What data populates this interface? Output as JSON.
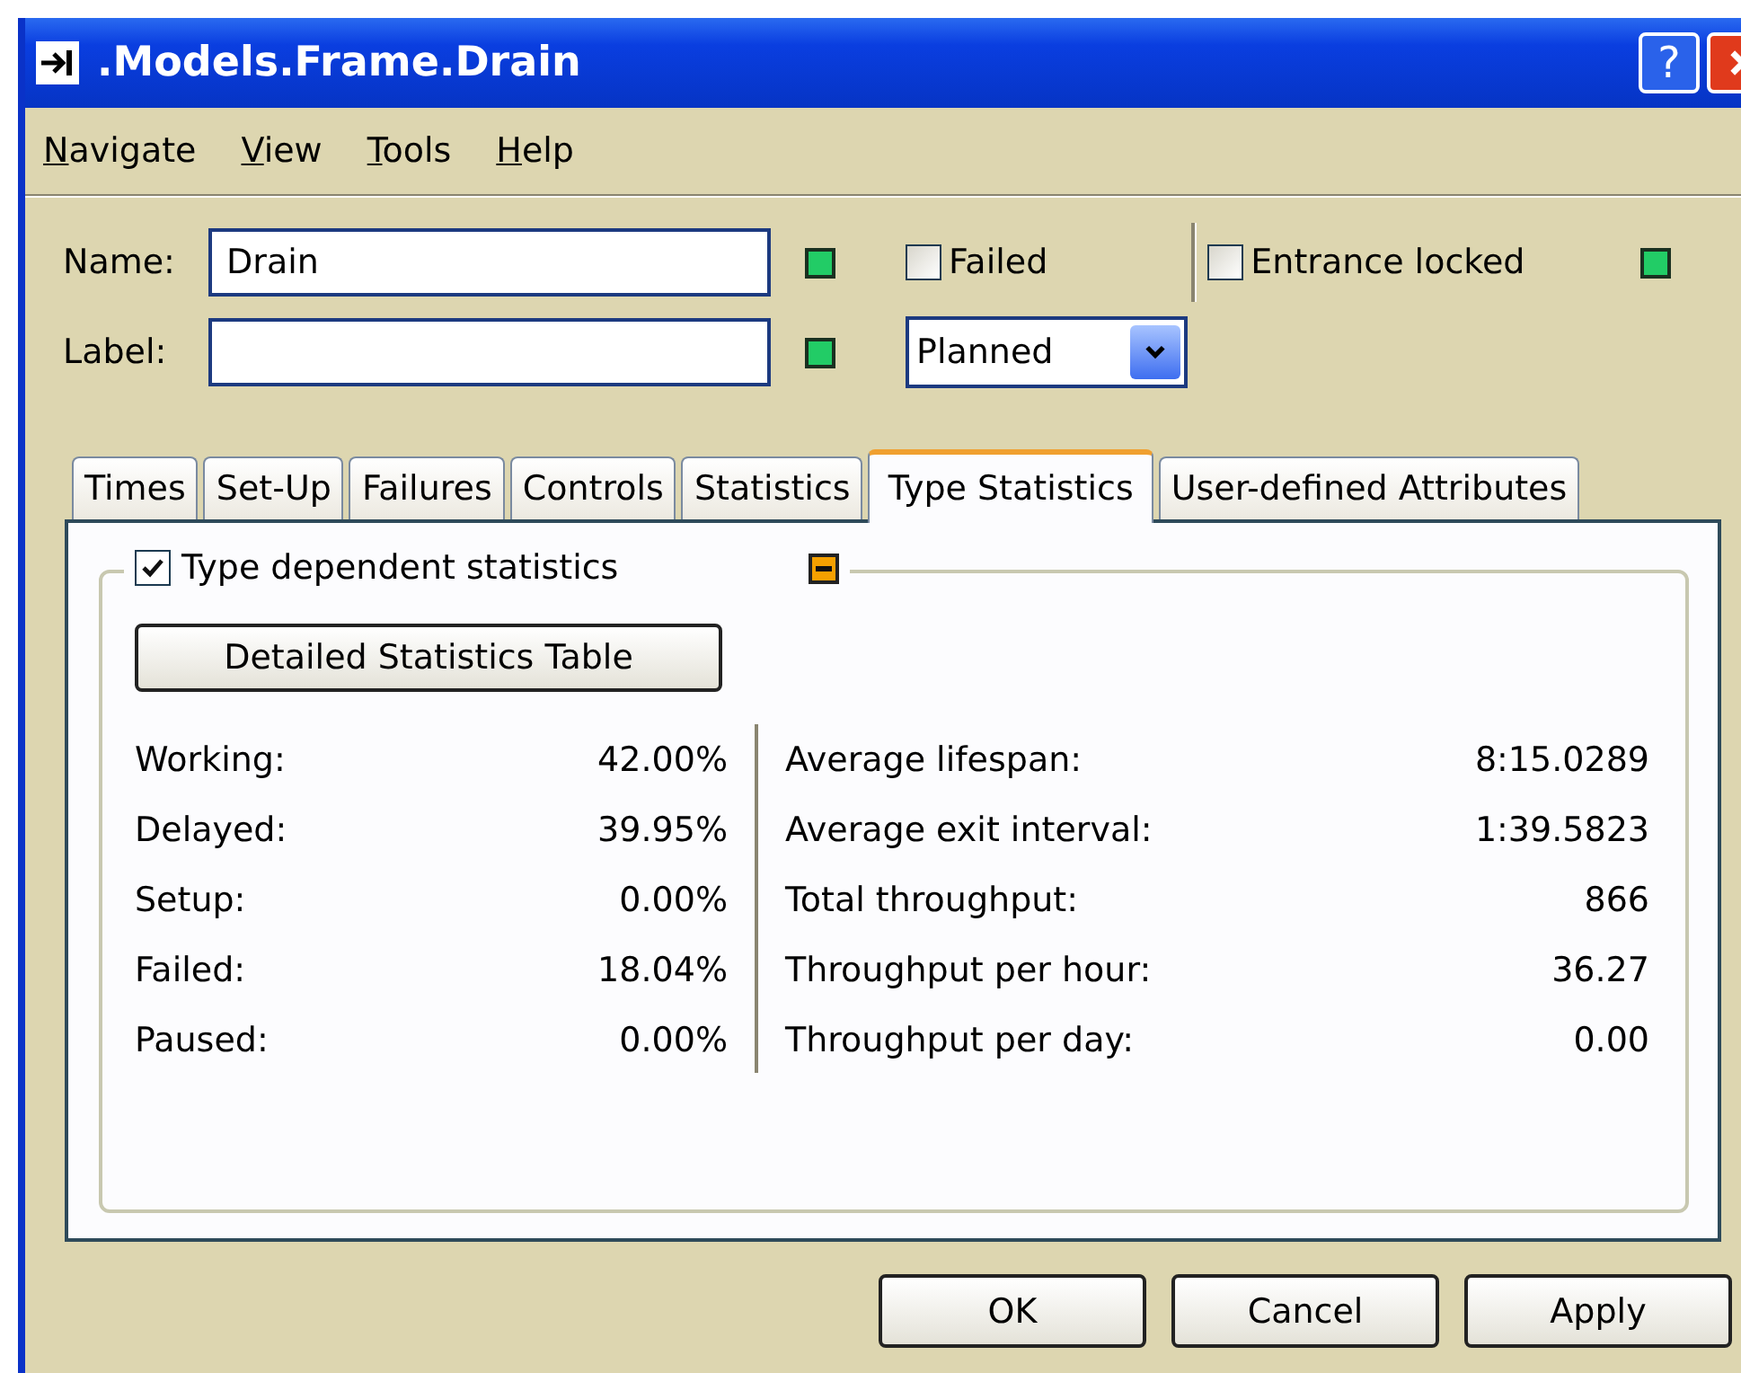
{
  "window": {
    "title": ".Models.Frame.Drain",
    "help_button": "?"
  },
  "menu": [
    "Navigate",
    "View",
    "Tools",
    "Help"
  ],
  "name_field": {
    "label": "Name:",
    "value": "Drain",
    "indicator": {
      "color": "#22cc66"
    }
  },
  "label_field": {
    "label": "Label:",
    "indicator": {
      "color": "#22cc66"
    }
  },
  "failed": {
    "label": "Failed",
    "checked": false
  },
  "entrance_locked": {
    "label": "Entrance locked",
    "checked": false,
    "indicator": {
      "color": "#22cc66"
    }
  },
  "mode_dropdown": {
    "value": "Planned"
  },
  "tabs": [
    {
      "label": "Times",
      "selected": false
    },
    {
      "label": "Set-Up",
      "selected": false
    },
    {
      "label": "Failures",
      "selected": false
    },
    {
      "label": "Controls",
      "selected": false
    },
    {
      "label": "Statistics",
      "selected": false
    },
    {
      "label": "Type Statistics",
      "selected": true
    },
    {
      "label": "User-defined Attributes",
      "selected": false
    }
  ],
  "group": {
    "label": "Type dependent statistics",
    "checked": true,
    "indicator": {
      "color": "#f5a000"
    },
    "button": "Detailed Statistics Table"
  },
  "left_stats": [
    {
      "label": "Working:",
      "value": "42.00%"
    },
    {
      "label": "Delayed:",
      "value": "39.95%"
    },
    {
      "label": "Setup:",
      "value": "0.00%"
    },
    {
      "label": "Failed:",
      "value": "18.04%"
    },
    {
      "label": "Paused:",
      "value": "0.00%"
    }
  ],
  "right_stats": [
    {
      "label": "Average lifespan:",
      "value": "8:15.0289"
    },
    {
      "label": "Average exit interval:",
      "value": "1:39.5823"
    },
    {
      "label": "Total throughput:",
      "value": "866"
    },
    {
      "label": "Throughput per hour:",
      "value": "36.27"
    },
    {
      "label": "Throughput per day:",
      "value": "0.00"
    }
  ],
  "buttons": [
    "OK",
    "Cancel",
    "Apply"
  ]
}
